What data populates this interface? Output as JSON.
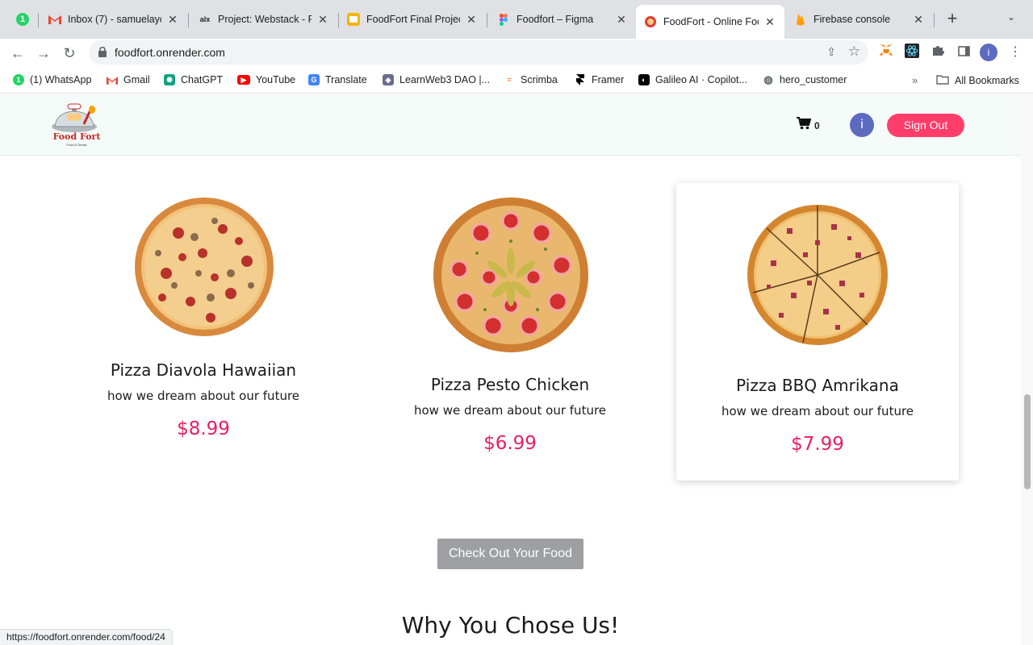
{
  "browser": {
    "tabs": [
      {
        "title": "",
        "icon": "whatsapp-icon",
        "badge": "1"
      },
      {
        "title": "Inbox (7) - samuelayo",
        "icon": "gmail-icon"
      },
      {
        "title": "Project: Webstack - P",
        "icon": "alx-icon"
      },
      {
        "title": "FoodFort Final Projec",
        "icon": "slides-icon"
      },
      {
        "title": "Foodfort – Figma",
        "icon": "figma-icon"
      },
      {
        "title": "FoodFort - Online Foo",
        "icon": "foodfort-icon",
        "active": true
      },
      {
        "title": "Firebase console",
        "icon": "firebase-icon"
      }
    ],
    "url": "foodfort.onrender.com",
    "profile_initial": "i",
    "bookmarks": [
      {
        "label": "(1) WhatsApp",
        "icon": "whatsapp-icon"
      },
      {
        "label": "Gmail",
        "icon": "gmail-icon"
      },
      {
        "label": "ChatGPT",
        "icon": "chatgpt-icon"
      },
      {
        "label": "YouTube",
        "icon": "youtube-icon"
      },
      {
        "label": "Translate",
        "icon": "translate-icon"
      },
      {
        "label": "LearnWeb3 DAO |...",
        "icon": "learnweb3-icon"
      },
      {
        "label": "Scrimba",
        "icon": "scrimba-icon"
      },
      {
        "label": "Framer",
        "icon": "framer-icon"
      },
      {
        "label": "Galileo AI · Copilot...",
        "icon": "galileo-icon"
      },
      {
        "label": "hero_customer",
        "icon": "globe-icon"
      }
    ],
    "all_bookmarks": "All Bookmarks",
    "status_url": "https://foodfort.onrender.com/food/24"
  },
  "site": {
    "logo_text": "Food Fort",
    "logo_sub": "Food & Drinks",
    "cart_count": "0",
    "avatar_initial": "i",
    "signout_label": "Sign Out",
    "checkout_label": "Check Out Your Food",
    "section_title": "Why You Chose Us!",
    "products": [
      {
        "name": "Pizza Diavola Hawaiian",
        "desc": "how we dream about our future",
        "price": "$8.99"
      },
      {
        "name": "Pizza Pesto Chicken",
        "desc": "how we dream about our future",
        "price": "$6.99"
      },
      {
        "name": "Pizza BBQ Amrikana",
        "desc": "how we dream about our future",
        "price": "$7.99"
      }
    ]
  },
  "colors": {
    "accent": "#ff3d6a",
    "price": "#e91e63",
    "header_bg": "#f5fbf8",
    "checkout_bg": "#9e9fa2"
  }
}
